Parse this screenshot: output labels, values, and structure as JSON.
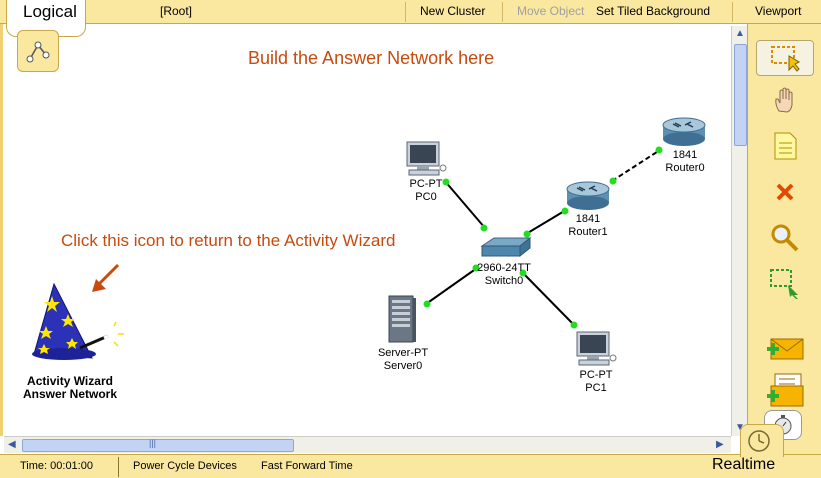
{
  "toolbar": {
    "mode_tab": "Logical",
    "root": "[Root]",
    "new_cluster": "New Cluster",
    "move_object": "Move Object",
    "set_tiled_background": "Set Tiled Background",
    "viewport": "Viewport"
  },
  "canvas": {
    "title": "Build the Answer Network here",
    "click_note": "Click this icon to return to the Activity Wizard",
    "wizard_label_line1": "Activity Wizard",
    "wizard_label_line2": "Answer Network"
  },
  "devices": {
    "pc0": {
      "type": "PC-PT",
      "name": "PC0"
    },
    "pc1": {
      "type": "PC-PT",
      "name": "PC1"
    },
    "server0": {
      "type": "Server-PT",
      "name": "Server0"
    },
    "switch0": {
      "type": "2960-24TT",
      "name": "Switch0"
    },
    "router0": {
      "type": "1841",
      "name": "Router0"
    },
    "router1": {
      "type": "1841",
      "name": "Router1"
    }
  },
  "colors": {
    "panel_bg": "#fbe8a0",
    "note_text": "#c84a0c",
    "link_up": "#22dd22"
  },
  "right_tools": [
    "select-icon",
    "hand-icon",
    "note-icon",
    "delete-icon",
    "inspect-icon",
    "resize-icon",
    "simple-pdu-icon",
    "complex-pdu-icon"
  ],
  "statusbar": {
    "time": "Time: 00:01:00",
    "power_cycle": "Power Cycle Devices",
    "fast_forward": "Fast Forward Time",
    "mode": "Realtime"
  },
  "scroll": {
    "grip": "|||"
  }
}
